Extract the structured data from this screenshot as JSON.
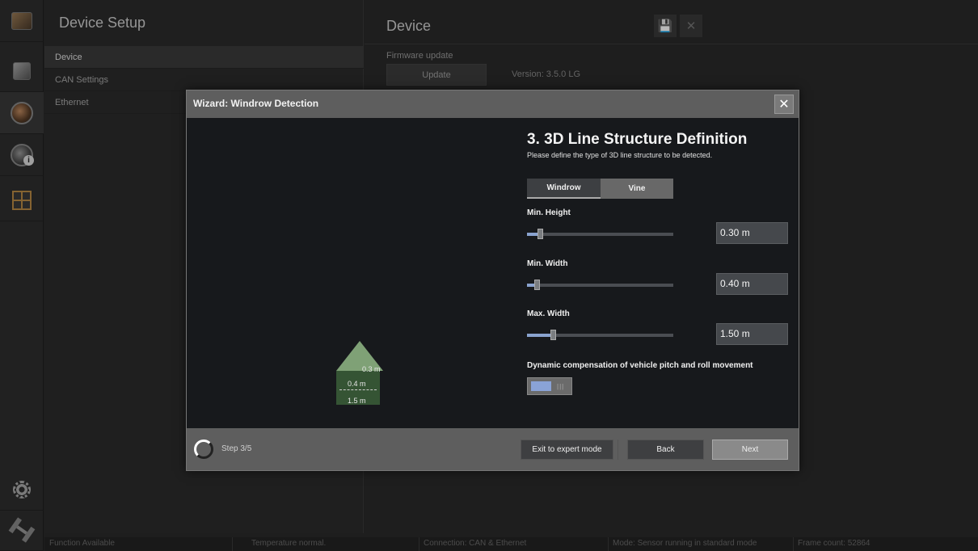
{
  "setup": {
    "title": "Device Setup",
    "nav": [
      "Device",
      "CAN Settings",
      "Ethernet"
    ]
  },
  "device": {
    "title": "Device",
    "firmware_label": "Firmware update",
    "update_button": "Update",
    "version": "Version: 3.5.0 LG"
  },
  "icons": {
    "rail": [
      "camera-image-icon",
      "edit-icon",
      "sensor-icon",
      "sensor-info-icon",
      "grid-target-icon",
      "settings-gear-icon",
      "satellite-icon"
    ],
    "save": "floppy-save-icon",
    "close": "close-icon"
  },
  "status": {
    "function": "Function Available",
    "temperature": "Temperature normal.",
    "connection": "Connection: CAN & Ethernet",
    "mode": "Mode: Sensor running in standard mode",
    "frames": "Frame count: 52864"
  },
  "wizard": {
    "title": "Wizard: Windrow Detection",
    "close_glyph": "✕",
    "step_title": "3. 3D Line Structure Definition",
    "step_sub": "Please define the type of 3D line structure to be detected.",
    "structure_types": [
      "Windrow",
      "Vine"
    ],
    "selected_type": "Windrow",
    "min_height": {
      "label": "Min. Height",
      "value": "0.30 m",
      "level": 0.07
    },
    "min_width": {
      "label": "Min. Width",
      "value": "0.40 m",
      "level": 0.05
    },
    "max_width": {
      "label": "Max. Width",
      "value": "1.50 m",
      "level": 0.16
    },
    "dynamic_label": "Dynamic compensation of vehicle pitch and roll movement",
    "dynamic_enabled": true,
    "illustration": {
      "height": "0.3 m",
      "min_width": "0.4 m",
      "max_width": "1.5 m"
    },
    "step_count": "Step 3/5",
    "buttons": {
      "expert": "Exit to expert mode",
      "back": "Back",
      "next": "Next"
    }
  },
  "colors": {
    "accent": "#8aa3cf",
    "structure_green": "#355434",
    "triangle_green": "#7fa176"
  }
}
